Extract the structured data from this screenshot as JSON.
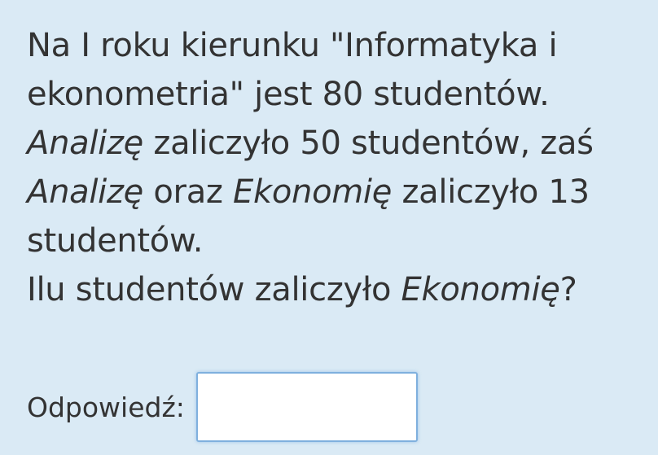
{
  "question": {
    "line1": "Na I roku kierunku \"Informatyka i",
    "line2": "ekonometria\" jest 80 studentów.",
    "line3_em": "Analizę",
    "line3_rest": " zaliczyło 50 studentów, zaś",
    "line4_em1": "Analizę",
    "line4_mid": " oraz ",
    "line4_em2": "Ekonomię",
    "line4_rest": " zaliczyło 13",
    "line5": "studentów.",
    "line6_start": "Ilu studentów zaliczyło ",
    "line6_em": "Ekonomię",
    "line6_end": "?"
  },
  "answer": {
    "label": "Odpowiedź:",
    "value": "",
    "placeholder": ""
  },
  "colors": {
    "background": "#daeaf5",
    "text": "#333333",
    "input_border": "#7fb0de"
  }
}
